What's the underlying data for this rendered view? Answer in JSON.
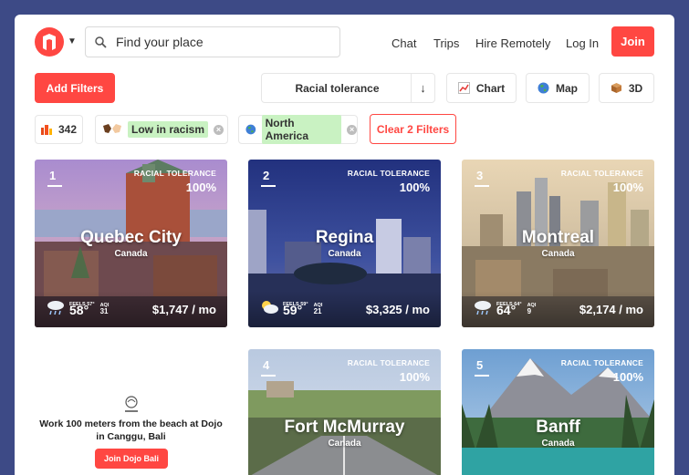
{
  "header": {
    "search_placeholder": "Find your place",
    "nav": [
      "Chat",
      "Trips",
      "Hire Remotely",
      "Log In"
    ],
    "join_label": "Join"
  },
  "filters": {
    "add_label": "Add Filters",
    "sort_label": "Racial tolerance",
    "sort_arrow": "↓",
    "views": [
      {
        "label": "Chart",
        "icon": "chart-icon"
      },
      {
        "label": "Map",
        "icon": "globe-icon"
      },
      {
        "label": "3D",
        "icon": "cube-icon"
      }
    ],
    "count": "342",
    "active": [
      {
        "label": "Low in racism",
        "icon": "handshake-icon"
      },
      {
        "label": "North America",
        "icon": "globe-icon"
      }
    ],
    "clear_label": "Clear 2 Filters"
  },
  "cards": [
    {
      "rank": "1",
      "metric": "RACIAL TOLERANCE",
      "pct": "100%",
      "city": "Quebec City",
      "country": "Canada",
      "feels_label": "FEELS 57°",
      "temp": "58°",
      "aqi_label": "AQI",
      "aqi": "31",
      "cost": "$1,747 / mo",
      "weather_icon": "rain-cloud-icon"
    },
    {
      "rank": "2",
      "metric": "RACIAL TOLERANCE",
      "pct": "100%",
      "city": "Regina",
      "country": "Canada",
      "feels_label": "FEELS 59°",
      "temp": "59°",
      "aqi_label": "AQI",
      "aqi": "21",
      "cost": "$3,325 / mo",
      "weather_icon": "partly-cloudy-icon"
    },
    {
      "rank": "3",
      "metric": "RACIAL TOLERANCE",
      "pct": "100%",
      "city": "Montreal",
      "country": "Canada",
      "feels_label": "FEELS 64°",
      "temp": "64°",
      "aqi_label": "AQI",
      "aqi": "9",
      "cost": "$2,174 / mo",
      "weather_icon": "rain-cloud-icon"
    },
    {
      "rank": "4",
      "metric": "RACIAL TOLERANCE",
      "pct": "100%",
      "city": "Fort McMurray",
      "country": "Canada"
    },
    {
      "rank": "5",
      "metric": "RACIAL TOLERANCE",
      "pct": "100%",
      "city": "Banff",
      "country": "Canada"
    }
  ],
  "ad": {
    "text": "Work 100 meters from the beach at Dojo in Canggu, Bali",
    "button": "Join Dojo Bali"
  }
}
